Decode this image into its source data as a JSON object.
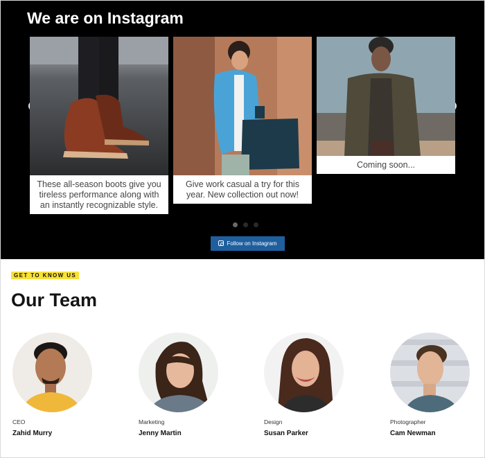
{
  "instagram": {
    "title": "We are on Instagram",
    "posts": [
      {
        "caption": "These all-season boots give you tireless performance along with an instantly recognizable style."
      },
      {
        "caption": "Give work casual a try for this year. New collection out now!"
      },
      {
        "caption": "Coming soon..."
      }
    ],
    "prev_icon": "chevron-left-icon",
    "next_icon": "chevron-right-icon",
    "pagination": {
      "total": 3,
      "active": 1
    },
    "follow_label": "Follow on Instagram"
  },
  "team": {
    "eyebrow": "GET TO KNOW US",
    "title": "Our Team",
    "members": [
      {
        "role": "CEO",
        "name": "Zahid Murry"
      },
      {
        "role": "Marketing",
        "name": "Jenny Martin"
      },
      {
        "role": "Design",
        "name": "Susan Parker"
      },
      {
        "role": "Photographer",
        "name": "Cam Newman"
      }
    ]
  },
  "colors": {
    "accent_blue": "#1f5f9e",
    "eyebrow_yellow": "#f7e13b",
    "dark_bg": "#000000"
  }
}
